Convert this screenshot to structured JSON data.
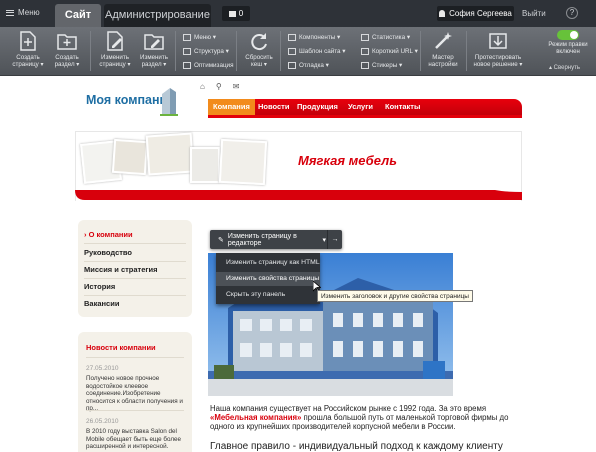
{
  "topbar": {
    "menu_label": "Меню",
    "tabs": [
      {
        "label": "Сайт",
        "active": true
      },
      {
        "label": "Администрирование",
        "active": false
      }
    ],
    "notifications_count": "0",
    "user_name": "София Сергеева",
    "logout_label": "Выйти",
    "help_label": "?"
  },
  "toolbar": {
    "buttons": [
      {
        "label_1": "Создать",
        "label_2": "страницу ▾",
        "icon": "page-add-icon"
      },
      {
        "label_1": "Создать",
        "label_2": "раздел ▾",
        "icon": "folder-add-icon"
      },
      {
        "label_1": "Изменить",
        "label_2": "страницу ▾",
        "icon": "page-edit-icon"
      },
      {
        "label_1": "Изменить",
        "label_2": "раздел ▾",
        "icon": "folder-edit-icon"
      }
    ],
    "col1": [
      "Меню ▾",
      "Структура ▾",
      "Оптимизация"
    ],
    "reset_cache": {
      "label_1": "Сбросить",
      "label_2": "кеш ▾"
    },
    "col2": [
      "Компоненты ▾",
      "Шаблон сайта ▾",
      "Отладка ▾"
    ],
    "col3": [
      "Статистика ▾",
      "Короткий URL ▾",
      "Стикеры ▾"
    ],
    "wizard": {
      "label_1": "Мастер",
      "label_2": "настройки"
    },
    "test_solution": {
      "label_1": "Протестировать",
      "label_2": "новое решение ▾"
    },
    "edit_mode": {
      "label_1": "Режим правки",
      "label_2": "включен",
      "on": true
    },
    "collapse_label": "▴ Свернуть"
  },
  "site": {
    "logo": "Моя компания",
    "nav": [
      "Компания",
      "Новости",
      "Продукция",
      "Услуги",
      "Контакты"
    ],
    "banner_title": "Мягкая мебель",
    "sidebar": [
      "О компании",
      "Руководство",
      "Миссия и стратегия",
      "История",
      "Вакансии"
    ],
    "news": {
      "title": "Новости компании",
      "items": [
        {
          "date": "27.05.2010",
          "text": "Получено новое прочное водостойкое клеевое соединение.Изобретение относится к области получения и пр..."
        },
        {
          "date": "26.05.2010",
          "text": "В 2010 году выставка Salon del Mobile обещает быть еще более расширенной и интересной."
        }
      ]
    },
    "intro_1": "Наша компания существует на Российском рынке с 1992 года. За это время",
    "intro_brand": "«Мебельная компания»",
    "intro_2": " прошла большой путь от маленькой торговой фирмы до одного из крупнейших производителей корпусной мебели в России.",
    "heading": "Главное правило - индивидуальный подход к каждому клиенту"
  },
  "editor": {
    "main_label": "Изменить страницу в редакторе",
    "more_label": "▾",
    "arrow_label": "→",
    "menu": [
      "Изменить страницу как HTML",
      "Изменить свойства страницы",
      "Скрыть эту панель"
    ],
    "hover_index": 1,
    "tooltip": "Изменить заголовок и другие свойства страницы"
  },
  "colors": {
    "accent_red": "#d8000c",
    "nav_active": "#f28b1c",
    "toggle_on": "#67c23a",
    "logo_blue": "#1e6ea3"
  }
}
